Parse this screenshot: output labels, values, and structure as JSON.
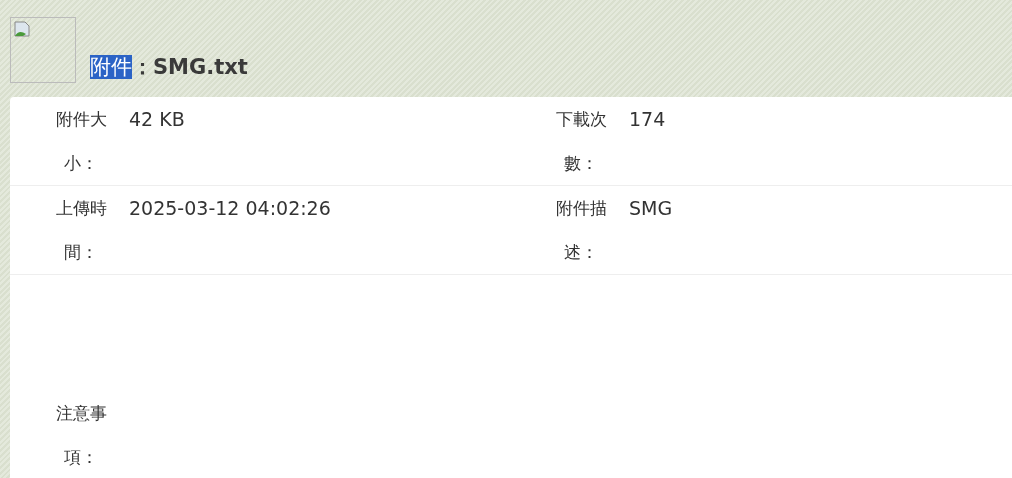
{
  "header": {
    "label": "附件",
    "label_selected": true,
    "value": "：SMG.txt"
  },
  "rows": [
    {
      "cells": [
        {
          "label": "附件大小：",
          "value": "42 KB"
        },
        {
          "label": "下載次數：",
          "value": "174"
        }
      ]
    },
    {
      "cells": [
        {
          "label": "上傳時間：",
          "value": "2025-03-12 04:02:26"
        },
        {
          "label": "附件描述：",
          "value": "SMG"
        }
      ]
    },
    {
      "tall": true,
      "cells": [
        {
          "label": "注意事項："
        }
      ]
    }
  ]
}
